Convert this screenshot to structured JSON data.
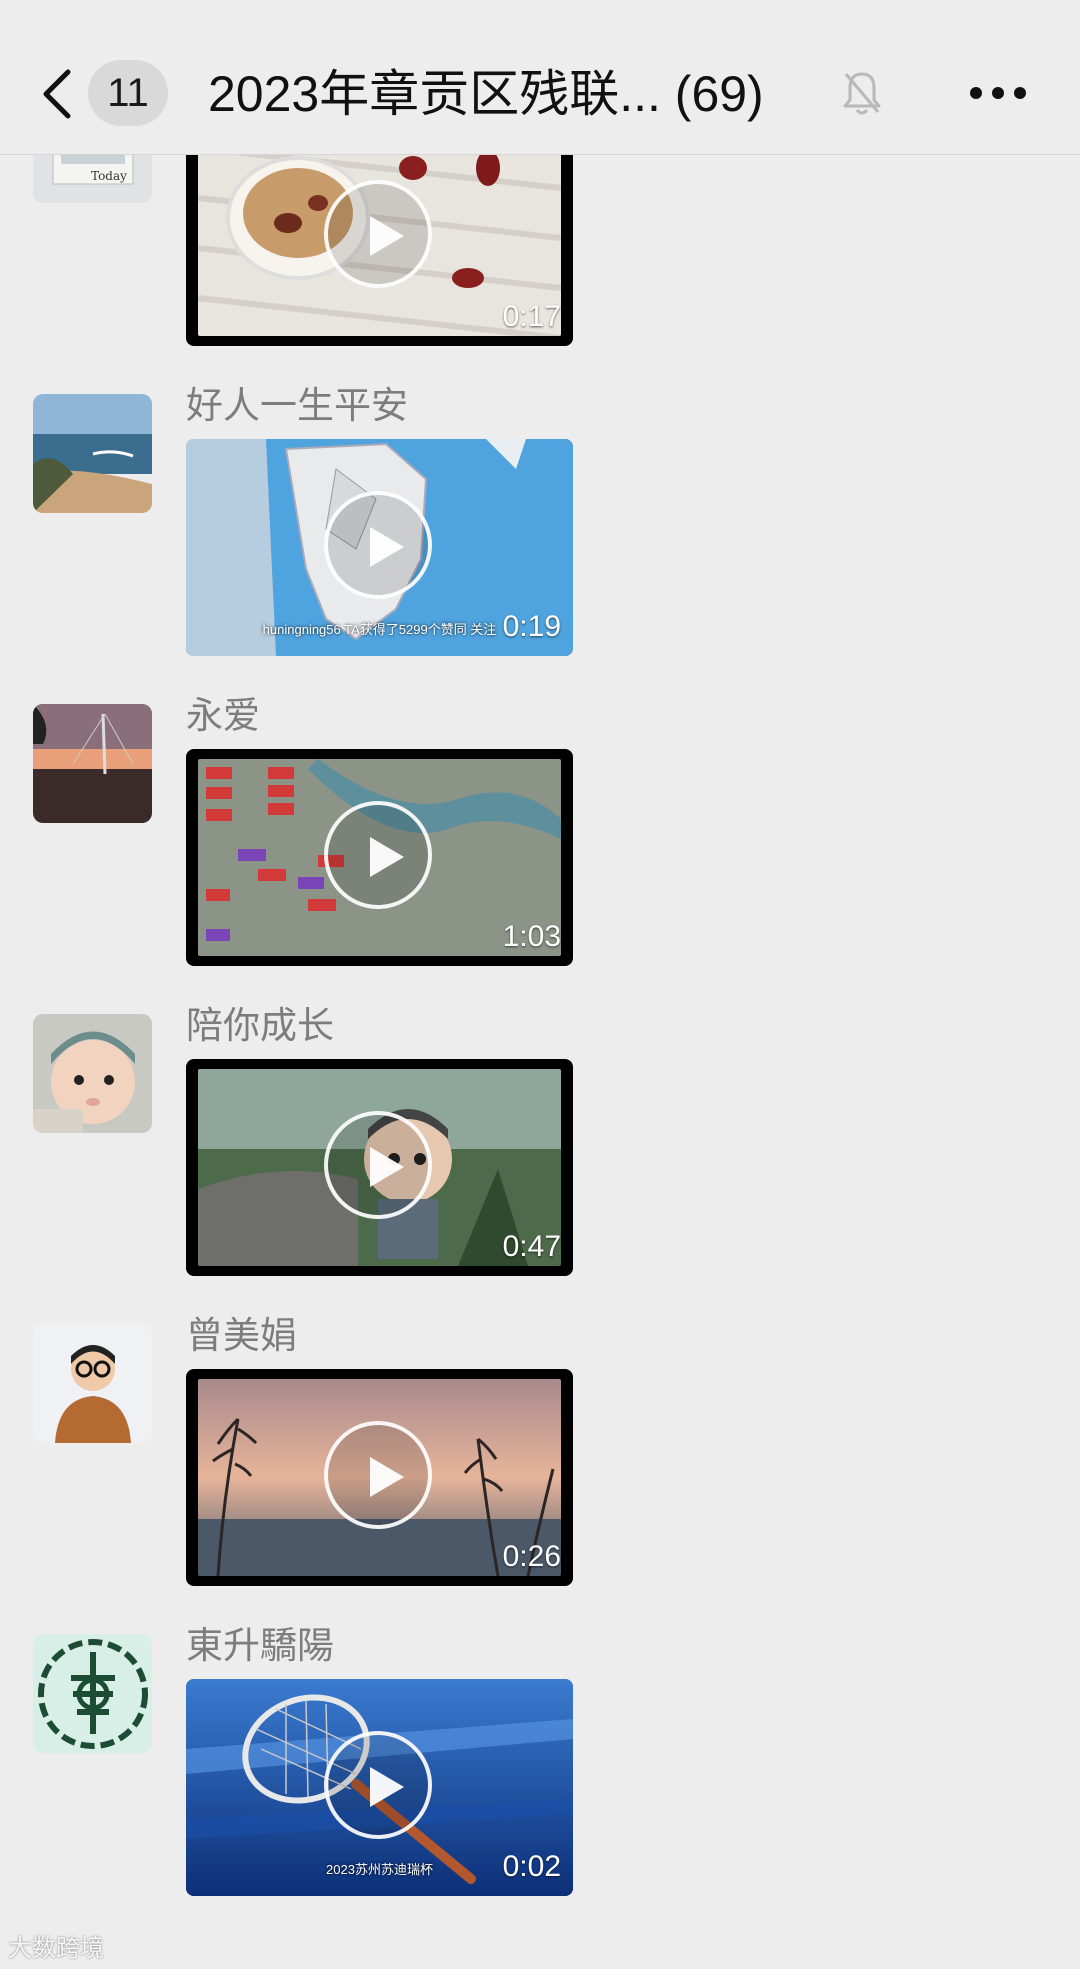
{
  "header": {
    "back_icon": "chevron-left-icon",
    "unread_badge": "11",
    "title": "2023年章贡区残联... (69)",
    "mute_icon": "bell-slash-icon",
    "more_icon": "more-dots-icon"
  },
  "messages": [
    {
      "sender": "",
      "duration": "0:17",
      "caption": "",
      "theme": "food"
    },
    {
      "sender": "好人一生平安",
      "duration": "0:19",
      "caption": "huningning56 TA获得了5299个赞同 关注",
      "theme": "map-blue"
    },
    {
      "sender": "永爱",
      "duration": "1:03",
      "caption": "",
      "theme": "city-map"
    },
    {
      "sender": "陪你成长",
      "duration": "0:47",
      "caption": "",
      "theme": "cartoon"
    },
    {
      "sender": "曾美娟",
      "duration": "0:26",
      "caption": "",
      "theme": "reeds"
    },
    {
      "sender": "東升驕陽",
      "duration": "0:02",
      "caption": "2023苏州苏迪瑞杯",
      "theme": "tennis"
    }
  ],
  "watermark": "大数跨境",
  "colors": {
    "background": "#ededed",
    "header_text": "#111111",
    "sender_text": "#7d7d7d"
  }
}
